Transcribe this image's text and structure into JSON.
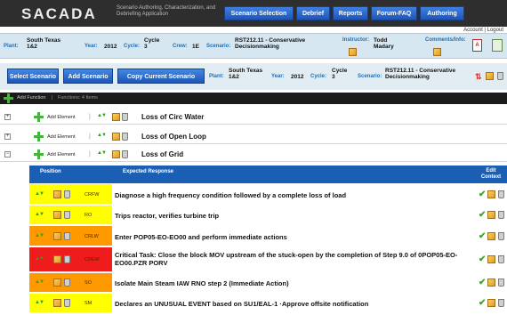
{
  "header": {
    "logo": "SACADA",
    "tagline": "Scenario Authoring, Characterization, and Debriefing Application",
    "nav": [
      "Scenario Selection",
      "Debrief",
      "Reports",
      "Forum-FAQ",
      "Authoring"
    ],
    "account": "Account | Logout"
  },
  "plant_bar": {
    "plant_label": "Plant:",
    "plant": "South Texas 1&2",
    "year_label": "Year:",
    "year": "2012",
    "cycle_label": "Cycle:",
    "cycle": "Cycle 3",
    "crew_label": "Crew:",
    "crew": "1E",
    "scenario_label": "Scenario:",
    "scenario": "RST212.11 - Conservative Decisionmaking",
    "instructor_label": "Instructor:",
    "instructor": "Todd Madary",
    "comments_label": "Comments/Info:"
  },
  "action_bar": {
    "buttons": [
      "Select Scenario",
      "Add Scenario",
      "Copy Current Scenario"
    ],
    "plant_label": "Plant:",
    "plant": "South Texas 1&2",
    "year_label": "Year:",
    "year": "2012",
    "cycle_label": "Cycle:",
    "cycle": "Cycle 3",
    "scenario_label": "Scenario:",
    "scenario": "RST212.11 - Conservative Decisionmaking"
  },
  "function_bar": {
    "add_function": "Add Function",
    "functions_count": "Functions: 4 Items"
  },
  "groups": [
    {
      "expand": "+",
      "add_element": "Add Element",
      "title": "Loss of Circ Water"
    },
    {
      "expand": "+",
      "add_element": "Add Element",
      "title": "Loss of Open Loop"
    },
    {
      "expand": "−",
      "add_element": "Add Element",
      "title": "Loss of Grid"
    }
  ],
  "table": {
    "headers": {
      "position": "Position",
      "expected": "Expected Response",
      "edit_context": "Edit Context"
    },
    "rows": [
      {
        "code": "CRFW",
        "text": "Diagnose a high frequency condition followed by a complete loss of load",
        "color": "#ffff00"
      },
      {
        "code": "RO",
        "text": "Trips reactor, verifies turbine trip",
        "color": "#ffff00"
      },
      {
        "code": "CRLW",
        "text": "Enter POP05-EO-EO00 and perform immediate actions",
        "color": "#ff9900"
      },
      {
        "code": "CREW",
        "text": "Critical Task: Close the block MOV upstream of the stuck-open by the completion of Step 9.0 of 0POP05-EO-EO00.PZR PORV",
        "color": "#ee1c1c"
      },
      {
        "code": "SO",
        "text": "Isolate Main Steam IAW RNO step 2 (Immediate Action)",
        "color": "#ff9900"
      },
      {
        "code": "SM",
        "text": "Declares an UNUSUAL EVENT based on SU1/EAL-1 ·Approve offsite notification",
        "color": "#ffff00"
      }
    ]
  },
  "colors": {
    "nav_blue": "#1f55b8",
    "header_dark": "#2e2e2e",
    "table_header": "#1b5fb4"
  },
  "icons": [
    "pencil-icon",
    "trash-icon",
    "plus-icon",
    "up-arrow-icon",
    "down-arrow-icon",
    "check-icon",
    "pdf-icon"
  ]
}
